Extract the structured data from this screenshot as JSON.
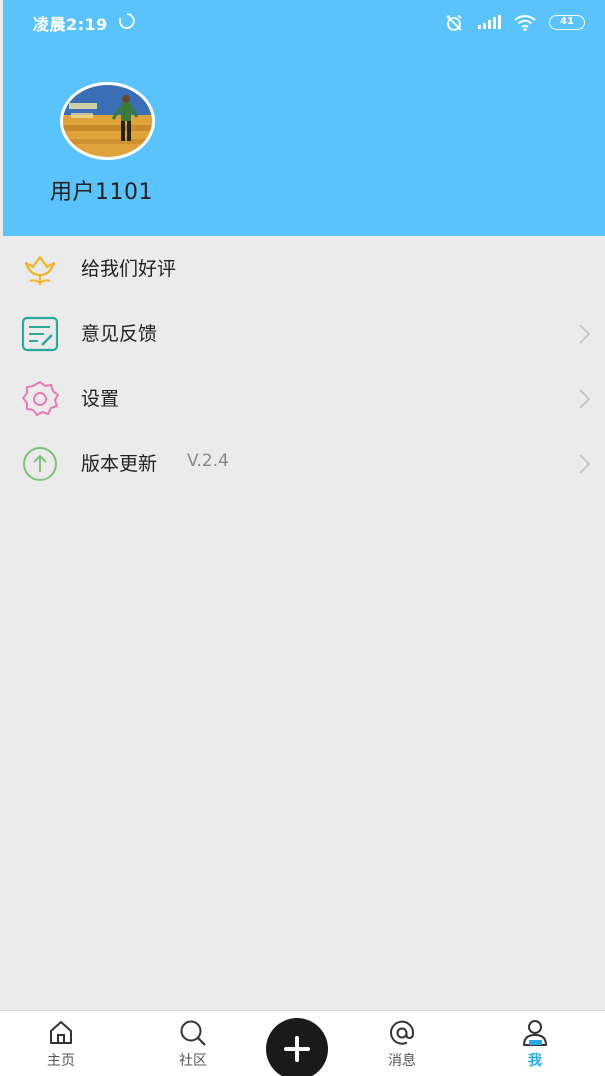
{
  "status_bar": {
    "time": "凌晨2:19",
    "battery": "41"
  },
  "profile": {
    "username": "用户1101"
  },
  "menu": [
    {
      "label": "给我们好评",
      "icon": "flower-icon",
      "color": "#f0b429"
    },
    {
      "label": "意见反馈",
      "icon": "feedback-icon",
      "color": "#2aa89a"
    },
    {
      "label": "设置",
      "icon": "settings-gear-icon",
      "color": "#e97ab8"
    },
    {
      "label": "版本更新",
      "version": "V.2.4",
      "icon": "upload-arrow-icon",
      "color": "#7cc47a"
    }
  ],
  "tabbar": {
    "home": "主页",
    "community": "社区",
    "messages": "消息",
    "me": "我"
  },
  "colors": {
    "header": "#5ac4fa",
    "background": "#ebebeb",
    "active_tab": "#2aa8e4"
  }
}
